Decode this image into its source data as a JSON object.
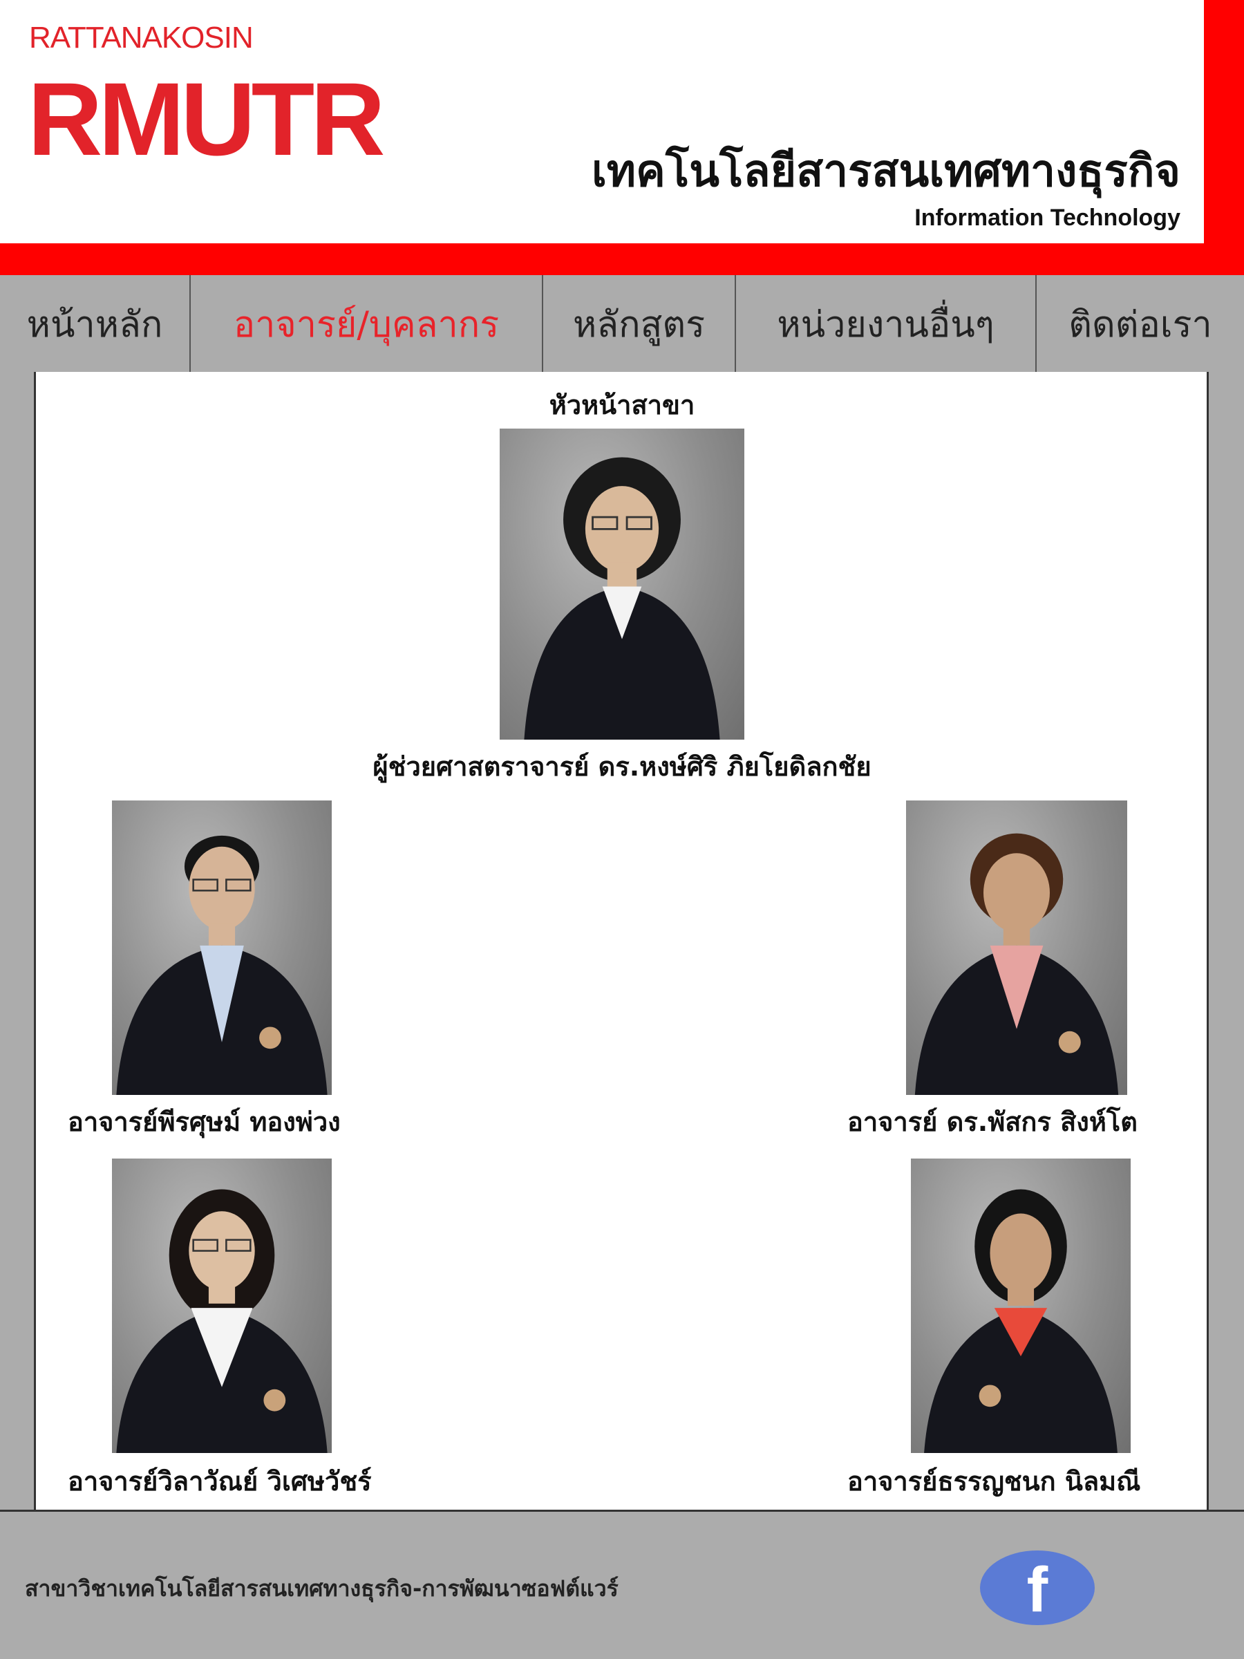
{
  "header": {
    "logo_top": "RATTANAKOSIN",
    "logo_mark": "RMUTR",
    "title_th": "เทคโนโลยีสารสนเทศทางธุรกิจ",
    "title_en": "Information Technology",
    "accent_color": "#ff0000"
  },
  "nav": {
    "items": [
      {
        "label": "หน้าหลัก",
        "active": false
      },
      {
        "label": "อาจารย์/บุคลากร",
        "active": true
      },
      {
        "label": "หลักสูตร",
        "active": false
      },
      {
        "label": "หน่วยงานอื่นๆ",
        "active": false
      },
      {
        "label": "ติดต่อเรา",
        "active": false
      }
    ],
    "active_color": "#e8232a"
  },
  "content": {
    "heading": "หัวหน้าสาขา",
    "head": {
      "name": "ผู้ช่วยศาสตราจารย์ ดร.หงษ์ศิริ ภิยโยดิลกชัย"
    },
    "staff": [
      {
        "name": "อาจารย์พีรศุษม์ ทองพ่วง"
      },
      {
        "name": "อาจารย์ ดร.พัสกร สิงห์โต"
      },
      {
        "name": "อาจารย์วิลาวัณย์ วิเศษวัชร์"
      },
      {
        "name": "อาจารย์ธรรญชนก นิลมณี"
      }
    ]
  },
  "footer": {
    "text": "สาขาวิชาเทคโนโลยีสารสนเทศทางธุรกิจ-การพัฒนาซอฟต์แวร์",
    "facebook_icon": "f"
  }
}
